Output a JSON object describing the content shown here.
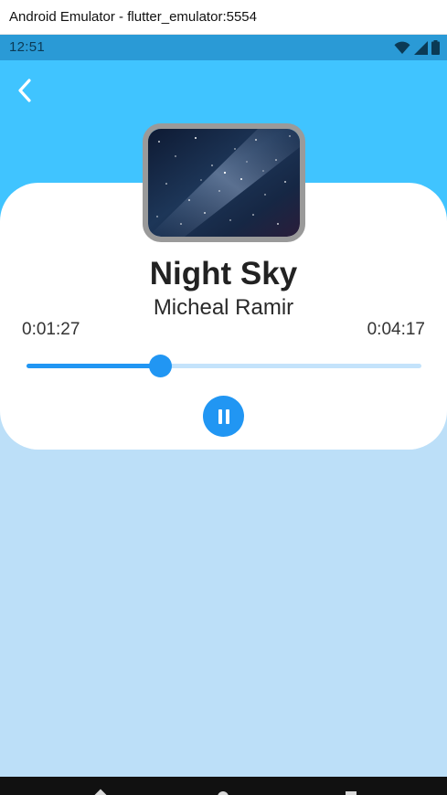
{
  "window": {
    "title": "Android Emulator - flutter_emulator:5554"
  },
  "status_bar": {
    "time": "12:51",
    "icons": [
      "wifi-icon",
      "cell-signal-icon",
      "battery-icon"
    ]
  },
  "player": {
    "album_art_icon": "night-sky-image",
    "title": "Night Sky",
    "artist": "Micheal Ramir",
    "elapsed": "0:01:27",
    "total": "0:04:17",
    "progress_fraction": 0.338,
    "is_playing": true
  },
  "icons": {
    "back": "back-arrow-icon",
    "pause": "pause-icon"
  },
  "nav_bar": {
    "items": [
      "back-nav-icon",
      "home-nav-icon",
      "recents-nav-icon"
    ]
  },
  "colors": {
    "header": "#40c4ff",
    "body_bg": "#bcdff8",
    "status_bar": "#2a9ad6",
    "accent": "#2196f3",
    "track": "#c4e3fb",
    "album_border": "#9a9a9a"
  }
}
